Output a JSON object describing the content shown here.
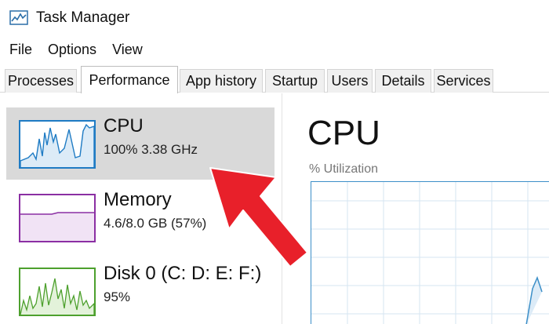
{
  "window": {
    "title": "Task Manager"
  },
  "menu": [
    "File",
    "Options",
    "View"
  ],
  "tabs": [
    {
      "label": "Processes",
      "active": false
    },
    {
      "label": "Performance",
      "active": true
    },
    {
      "label": "App history",
      "active": false
    },
    {
      "label": "Startup",
      "active": false
    },
    {
      "label": "Users",
      "active": false
    },
    {
      "label": "Details",
      "active": false
    },
    {
      "label": "Services",
      "active": false
    }
  ],
  "sidebar": {
    "items": [
      {
        "name": "CPU",
        "detail": "100%  3.38 GHz",
        "selected": true,
        "color": "#1e7bc4"
      },
      {
        "name": "Memory",
        "detail": "4.6/8.0 GB (57%)",
        "selected": false,
        "color": "#8b2fa3"
      },
      {
        "name": "Disk 0 (C: D: E: F:)",
        "detail": "95%",
        "selected": false,
        "color": "#4da02d"
      }
    ]
  },
  "main": {
    "title": "CPU",
    "graph_label": "% Utilization"
  },
  "annotation": {
    "arrow_color": "#e8202a"
  }
}
